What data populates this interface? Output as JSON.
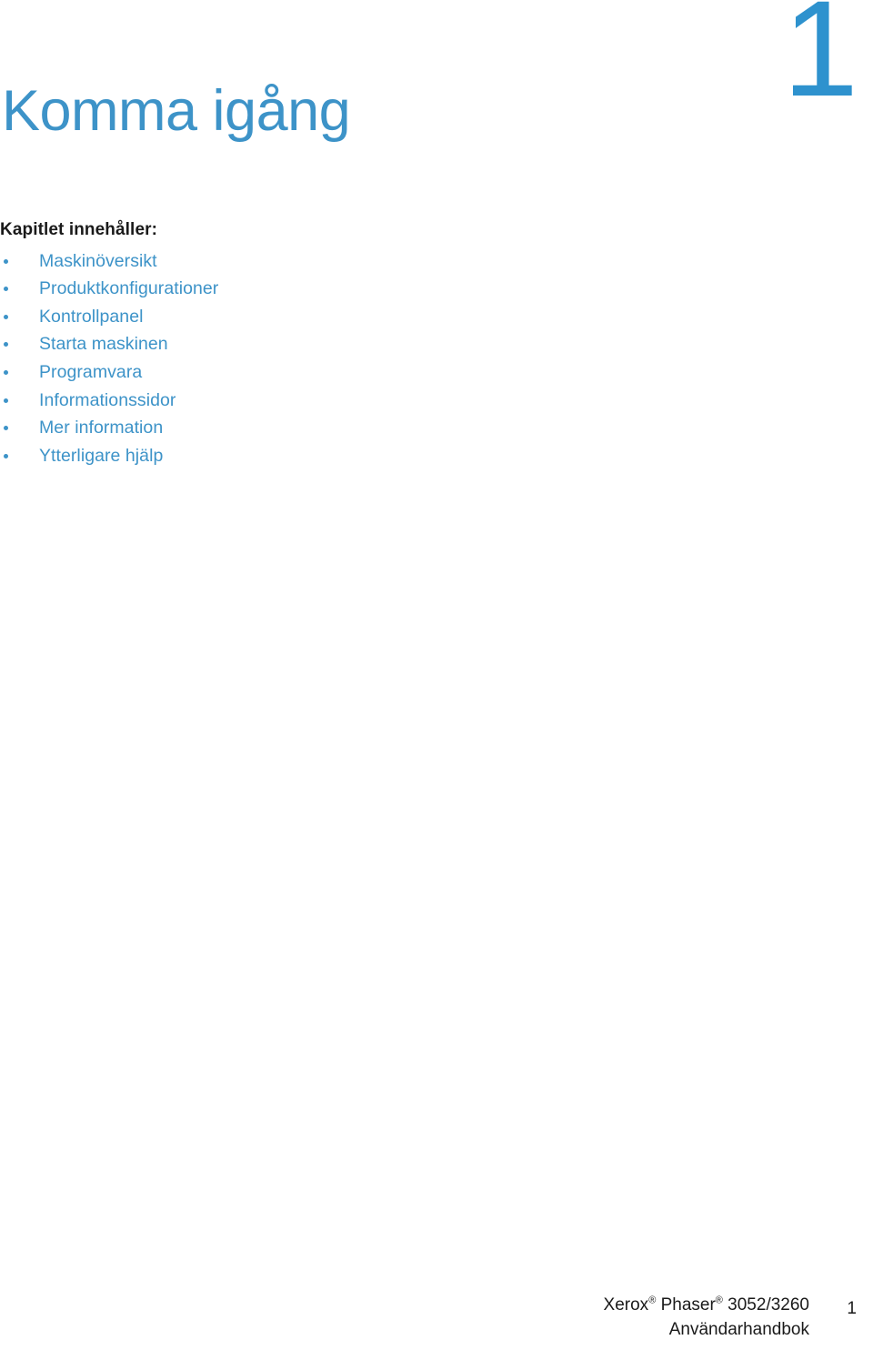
{
  "page": {
    "background_color": "#ffffff",
    "accent_color": "#3d93c8",
    "chapter_number_color": "#2e92ce",
    "text_color": "#1a1a1a"
  },
  "header": {
    "chapter_title": "Komma igång",
    "chapter_number": "1"
  },
  "contents": {
    "heading": "Kapitlet innehåller:",
    "items": [
      {
        "label": "Maskinöversikt"
      },
      {
        "label": "Produktkonfigurationer"
      },
      {
        "label": "Kontrollpanel"
      },
      {
        "label": "Starta maskinen"
      },
      {
        "label": "Programvara"
      },
      {
        "label": "Informationssidor"
      },
      {
        "label": "Mer information"
      },
      {
        "label": "Ytterligare hjälp"
      }
    ]
  },
  "footer": {
    "brand": "Xerox",
    "registered_mark": "®",
    "product_family": "Phaser",
    "model": "3052/3260",
    "document_type": "Användarhandbok",
    "page_number": "1"
  }
}
